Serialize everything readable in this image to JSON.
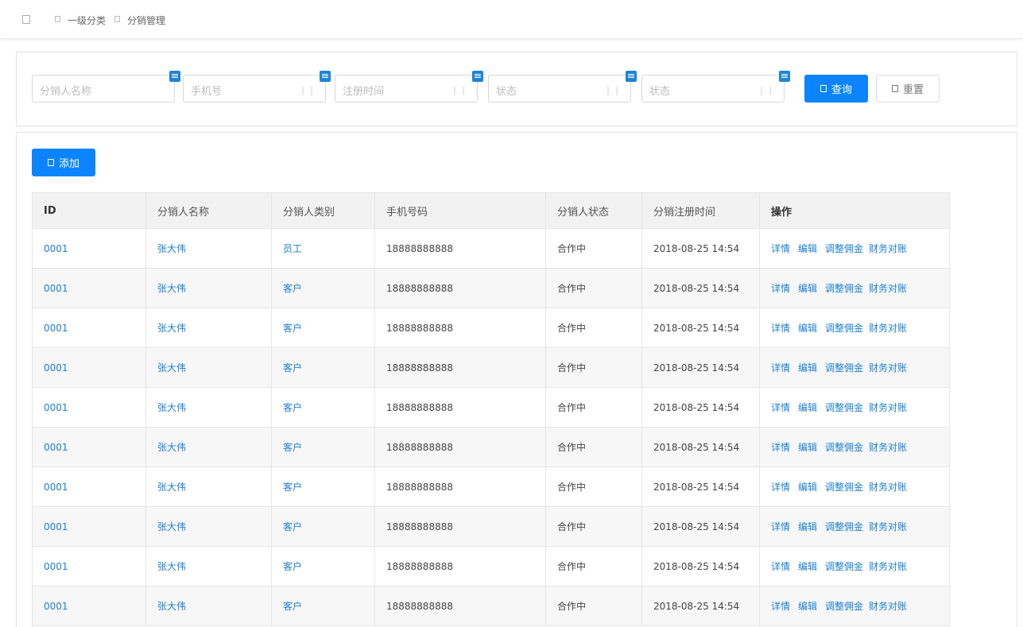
{
  "breadcrumb": [
    "一级分类",
    "分销管理"
  ],
  "filters": [
    {
      "placeholder": "分销人名称"
    },
    {
      "placeholder": "手机号"
    },
    {
      "placeholder": "注册时间"
    },
    {
      "placeholder": "状态"
    },
    {
      "placeholder": "状态"
    }
  ],
  "buttons": {
    "query": "查询",
    "reset": "重置",
    "add": "添加"
  },
  "table": {
    "columns": [
      "ID",
      "分销人名称",
      "分销人类别",
      "手机号码",
      "分销人状态",
      "分销注册时间",
      "操作"
    ],
    "actions": [
      "详情",
      "编辑",
      "调整佣金",
      "财务对账"
    ],
    "rows": [
      {
        "id": "0001",
        "name": "张大伟",
        "type": "员工",
        "phone": "18888888888",
        "status": "合作中",
        "time": "2018-08-25 14:54"
      },
      {
        "id": "0001",
        "name": "张大伟",
        "type": "客户",
        "phone": "18888888888",
        "status": "合作中",
        "time": "2018-08-25 14:54"
      },
      {
        "id": "0001",
        "name": "张大伟",
        "type": "客户",
        "phone": "18888888888",
        "status": "合作中",
        "time": "2018-08-25 14:54"
      },
      {
        "id": "0001",
        "name": "张大伟",
        "type": "客户",
        "phone": "18888888888",
        "status": "合作中",
        "time": "2018-08-25 14:54"
      },
      {
        "id": "0001",
        "name": "张大伟",
        "type": "客户",
        "phone": "18888888888",
        "status": "合作中",
        "time": "2018-08-25 14:54"
      },
      {
        "id": "0001",
        "name": "张大伟",
        "type": "客户",
        "phone": "18888888888",
        "status": "合作中",
        "time": "2018-08-25 14:54"
      },
      {
        "id": "0001",
        "name": "张大伟",
        "type": "客户",
        "phone": "18888888888",
        "status": "合作中",
        "time": "2018-08-25 14:54"
      },
      {
        "id": "0001",
        "name": "张大伟",
        "type": "客户",
        "phone": "18888888888",
        "status": "合作中",
        "time": "2018-08-25 14:54"
      },
      {
        "id": "0001",
        "name": "张大伟",
        "type": "客户",
        "phone": "18888888888",
        "status": "合作中",
        "time": "2018-08-25 14:54"
      },
      {
        "id": "0001",
        "name": "张大伟",
        "type": "客户",
        "phone": "18888888888",
        "status": "合作中",
        "time": "2018-08-25 14:54"
      }
    ]
  }
}
